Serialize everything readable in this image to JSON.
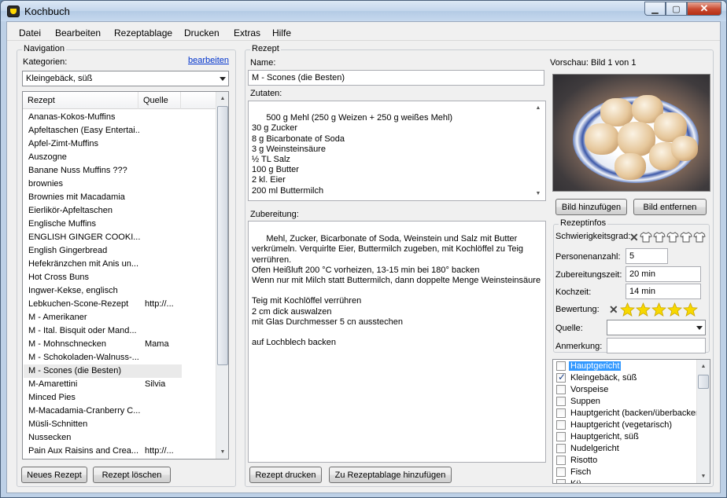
{
  "window": {
    "title": "Kochbuch"
  },
  "menu": [
    {
      "label": "Datei"
    },
    {
      "label": "Bearbeiten"
    },
    {
      "label": "Rezeptablage"
    },
    {
      "label": "Drucken"
    },
    {
      "label": "Extras"
    },
    {
      "label": "Hilfe"
    }
  ],
  "navigation": {
    "group_title": "Navigation",
    "categories_label": "Kategorien:",
    "edit_link": "bearbeiten",
    "selected_category": "Kleingebäck, süß",
    "columns": {
      "recipe": "Rezept",
      "source": "Quelle"
    },
    "rows": [
      {
        "name": "Ananas-Kokos-Muffins",
        "source": ""
      },
      {
        "name": "Apfeltaschen (Easy Entertai...",
        "source": ""
      },
      {
        "name": "Apfel-Zimt-Muffins",
        "source": ""
      },
      {
        "name": "Auszogne",
        "source": ""
      },
      {
        "name": "Banane Nuss Muffins ???",
        "source": ""
      },
      {
        "name": "brownies",
        "source": ""
      },
      {
        "name": "Brownies mit Macadamia",
        "source": ""
      },
      {
        "name": "Eierlikör-Apfeltaschen",
        "source": ""
      },
      {
        "name": "Englische Muffins",
        "source": ""
      },
      {
        "name": "ENGLISH GINGER COOKI...",
        "source": ""
      },
      {
        "name": "English Gingerbread",
        "source": ""
      },
      {
        "name": "Hefekränzchen mit Anis un...",
        "source": ""
      },
      {
        "name": "Hot Cross Buns",
        "source": ""
      },
      {
        "name": "Ingwer-Kekse, englisch",
        "source": ""
      },
      {
        "name": "Lebkuchen-Scone-Rezept",
        "source": "http://..."
      },
      {
        "name": "M - Amerikaner",
        "source": ""
      },
      {
        "name": "M - Ital. Bisquit  oder Mand...",
        "source": ""
      },
      {
        "name": "M - Mohnschnecken",
        "source": "Mama"
      },
      {
        "name": "M - Schokoladen-Walnuss-...",
        "source": ""
      },
      {
        "name": "M - Scones (die Besten)",
        "source": ""
      },
      {
        "name": "M-Amarettini",
        "source": "Silvia"
      },
      {
        "name": "Minced Pies",
        "source": ""
      },
      {
        "name": "M-Macadamia-Cranberry C...",
        "source": ""
      },
      {
        "name": "Müsli-Schnitten",
        "source": ""
      },
      {
        "name": "Nussecken",
        "source": ""
      },
      {
        "name": "Pain Aux Raisins and Crea...",
        "source": "http://..."
      }
    ],
    "selected_row": 19,
    "new_button": "Neues Rezept",
    "delete_button": "Rezept löschen"
  },
  "recipe": {
    "group_title": "Rezept",
    "name_label": "Name:",
    "name_value": "M - Scones (die Besten)",
    "ingredients_label": "Zutaten:",
    "ingredients": "500 g Mehl (250 g Weizen + 250 g weißes Mehl)\n30 g Zucker\n8 g Bicarbonate of Soda\n3 g Weinsteinsäure\n½ TL Salz\n100 g Butter\n2 kl. Eier\n200 ml Buttermilch",
    "prep_label": "Zubereitung:",
    "prep": "Mehl, Zucker, Bicarbonate of Soda, Weinstein und Salz mit Butter\nverkrümeln. Verquirlte Eier, Buttermilch zugeben, mit Kochlöffel zu Teig\nverrühren.\nOfen Heißluft 200 °C vorheizen, 13-15 min bei 180° backen\nWenn nur mit Milch statt Buttermilch, dann doppelte Menge Weinsteinsäure\n\nTeig mit Kochlöffel verrühren\n2 cm dick auswalzen\nmit Glas Durchmesser 5 cn ausstechen\n\nauf Lochblech backen",
    "print_button": "Rezept drucken",
    "add_to_tray_button": "Zu Rezeptablage hinzufügen"
  },
  "preview": {
    "label": "Vorschau: Bild 1 von 1",
    "add_image_button": "Bild hinzufügen",
    "remove_image_button": "Bild entfernen"
  },
  "info": {
    "group_title": "Rezeptinfos",
    "difficulty_label": "Schwierigkeitsgrad:",
    "difficulty_max": 5,
    "difficulty_value": 0,
    "persons_label": "Personenanzahl:",
    "persons_value": "5",
    "prep_time_label": "Zubereitungszeit:",
    "prep_time_value": "20 min",
    "cook_time_label": "Kochzeit:",
    "cook_time_value": "14 min",
    "rating_label": "Bewertung:",
    "rating_max": 5,
    "rating_value": 5,
    "source_label": "Quelle:",
    "source_value": "",
    "note_label": "Anmerkung:",
    "note_value": ""
  },
  "category_checklist": [
    {
      "label": "Hauptgericht",
      "checked": false,
      "selected": true
    },
    {
      "label": "Kleingebäck, süß",
      "checked": true,
      "selected": false
    },
    {
      "label": "Vorspeise",
      "checked": false,
      "selected": false
    },
    {
      "label": "Suppen",
      "checked": false,
      "selected": false
    },
    {
      "label": "Hauptgericht (backen/überbacken)",
      "checked": false,
      "selected": false
    },
    {
      "label": "Hauptgericht (vegetarisch)",
      "checked": false,
      "selected": false
    },
    {
      "label": "Hauptgericht, süß",
      "checked": false,
      "selected": false
    },
    {
      "label": "Nudelgericht",
      "checked": false,
      "selected": false
    },
    {
      "label": "Risotto",
      "checked": false,
      "selected": false
    },
    {
      "label": "Fisch",
      "checked": false,
      "selected": false
    },
    {
      "label": "Kü...",
      "checked": false,
      "selected": false
    }
  ],
  "icons": {
    "app": "cooking-pot-icon",
    "difficulty_clear": "clear-x-icon",
    "difficulty": "chef-shirt-icon",
    "rating": "star-icon",
    "star_color": "#f7d800"
  }
}
